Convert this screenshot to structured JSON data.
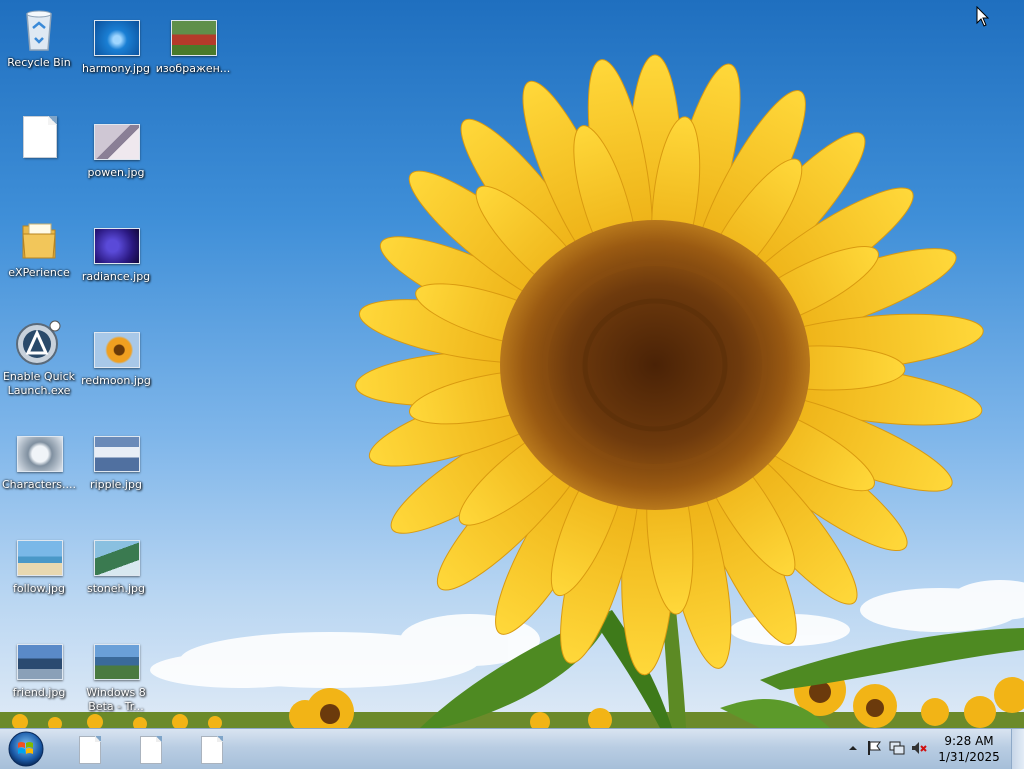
{
  "desktop": {
    "icons": [
      {
        "label": "Recycle Bin",
        "kind": "recycle-bin-icon"
      },
      {
        "label": "harmony.jpg",
        "kind": "image-thumbnail-icon",
        "color": "#1a7fd4"
      },
      {
        "label": "изображен...",
        "kind": "image-thumbnail-icon",
        "color": "#6a8f3a"
      },
      {
        "label": "",
        "kind": "blank-document-icon"
      },
      {
        "label": "powen.jpg",
        "kind": "image-thumbnail-icon",
        "color": "#9a8fa8"
      },
      {
        "label": "eXPerience",
        "kind": "folder-icon"
      },
      {
        "label": "radiance.jpg",
        "kind": "image-thumbnail-icon",
        "color": "#2a1880"
      },
      {
        "label": "Enable Quick Launch.exe",
        "kind": "app-icon"
      },
      {
        "label": "redmoon.jpg",
        "kind": "image-thumbnail-icon",
        "color": "#f0a020"
      },
      {
        "label": "Characters....",
        "kind": "image-thumbnail-icon",
        "color": "#8090a0"
      },
      {
        "label": "ripple.jpg",
        "kind": "image-thumbnail-icon",
        "color": "#5070a0"
      },
      {
        "label": "follow.jpg",
        "kind": "image-thumbnail-icon",
        "color": "#4a98c8"
      },
      {
        "label": "stoneh.jpg",
        "kind": "image-thumbnail-icon",
        "color": "#3a7a50"
      },
      {
        "label": "friend.jpg",
        "kind": "image-thumbnail-icon",
        "color": "#2a4a70"
      },
      {
        "label": "Windows 8 Beta - Tr...",
        "kind": "image-thumbnail-icon",
        "color": "#3a6a9a"
      }
    ]
  },
  "taskbar": {
    "start_icon": "windows-orb-icon",
    "pinned": [
      {
        "kind": "document-icon"
      },
      {
        "kind": "document-icon"
      },
      {
        "kind": "document-icon"
      }
    ],
    "tray": {
      "icons": [
        "chevron-up-icon",
        "action-center-flag-icon",
        "network-icon",
        "volume-muted-icon"
      ],
      "time": "9:28 AM",
      "date": "1/31/2025"
    }
  },
  "colors": {
    "sky": "#3f8fd8",
    "petal": "#f6c21a",
    "disc": "#7a3e0c",
    "taskbar": "#b9cde3"
  }
}
